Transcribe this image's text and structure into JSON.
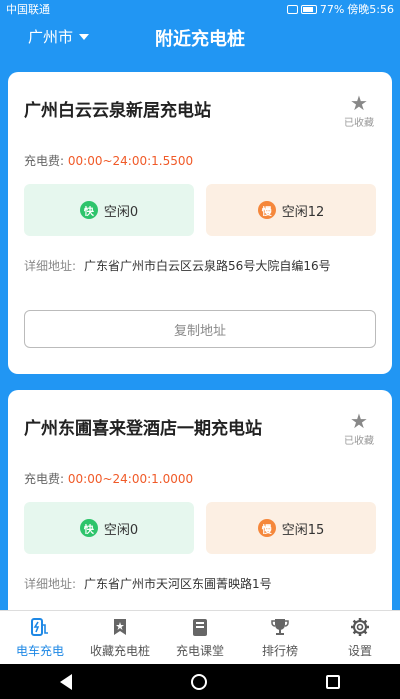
{
  "status_bar": {
    "carrier": "中国联通",
    "battery": "77%",
    "time": "傍晚5:56"
  },
  "header": {
    "city": "广州市",
    "title": "附近充电桩"
  },
  "stations": [
    {
      "name": "广州白云云泉新居充电站",
      "fav_label": "已收藏",
      "fee_label": "充电费:",
      "fee_value": "00:00~24:00:1.5500",
      "fast_badge": "快",
      "fast_text": "空闲0",
      "slow_badge": "慢",
      "slow_text": "空闲12",
      "addr_label": "详细地址:",
      "addr_value": "广东省广州市白云区云泉路56号大院自编16号",
      "copy_label": "复制地址"
    },
    {
      "name": "广州东圃喜来登酒店一期充电站",
      "fav_label": "已收藏",
      "fee_label": "充电费:",
      "fee_value": "00:00~24:00:1.0000",
      "fast_badge": "快",
      "fast_text": "空闲0",
      "slow_badge": "慢",
      "slow_text": "空闲15",
      "addr_label": "详细地址:",
      "addr_value": "广东省广州市天河区东圃菁映路1号"
    }
  ],
  "tabs": [
    {
      "label": "电车充电",
      "icon": "charging-icon",
      "active": true
    },
    {
      "label": "收藏充电桩",
      "icon": "bookmark-icon",
      "active": false
    },
    {
      "label": "充电课堂",
      "icon": "book-icon",
      "active": false
    },
    {
      "label": "排行榜",
      "icon": "trophy-icon",
      "active": false
    },
    {
      "label": "设置",
      "icon": "gear-icon",
      "active": false
    }
  ],
  "colors": {
    "primary": "#2196F3",
    "fee": "#F05A28",
    "fast": "#2EC46B",
    "slow": "#F5873B",
    "active_tab": "#1E88E5"
  }
}
